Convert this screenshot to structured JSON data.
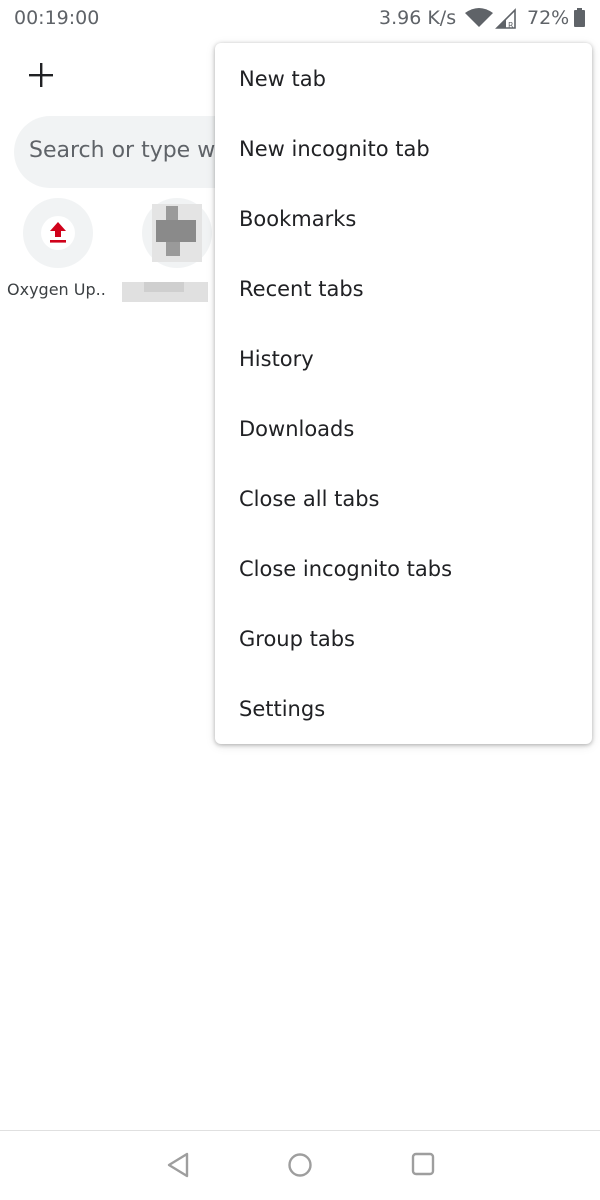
{
  "status_bar": {
    "time": "00:19:00",
    "net_speed": "3.96 K/s",
    "battery": "72%",
    "icons": [
      "wifi-icon",
      "signal-icon",
      "battery-icon"
    ]
  },
  "toolbar": {
    "new_tab_icon": "plus-icon"
  },
  "search": {
    "placeholder": "Search or type we"
  },
  "shortcuts": [
    {
      "label": "Oxygen Up..",
      "icon": "upload-icon",
      "icon_color": "#d0021b"
    },
    {
      "label": "",
      "icon": "blurred-favicon"
    }
  ],
  "menu": {
    "items": [
      {
        "label": "New tab"
      },
      {
        "label": "New incognito tab"
      },
      {
        "label": "Bookmarks"
      },
      {
        "label": "Recent tabs"
      },
      {
        "label": "History"
      },
      {
        "label": "Downloads"
      },
      {
        "label": "Close all tabs"
      },
      {
        "label": "Close incognito tabs"
      },
      {
        "label": "Group tabs"
      },
      {
        "label": "Settings"
      }
    ]
  },
  "nav_bar": {
    "icons": [
      "back-icon",
      "home-icon",
      "recents-icon"
    ]
  }
}
